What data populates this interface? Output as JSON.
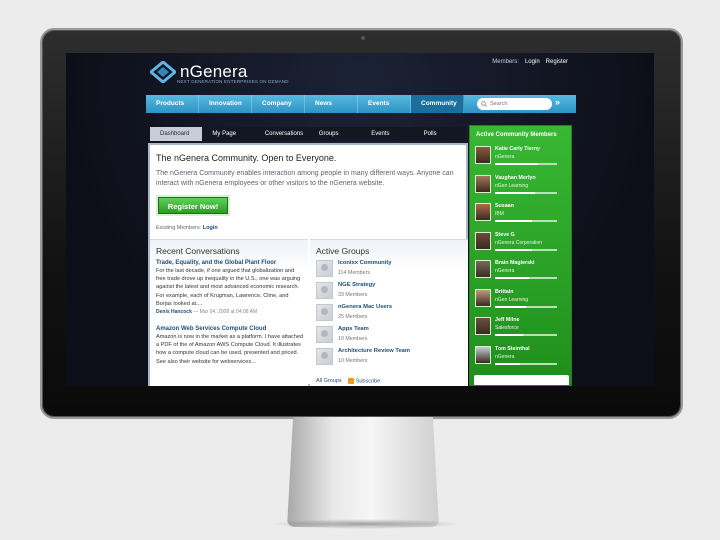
{
  "site": {
    "name": "nGenera",
    "tagline": "NEXT GENERATION ENTERPRISES ON DEMAND"
  },
  "toplinks": {
    "members_label": "Members:",
    "login": "Login",
    "register": "Register"
  },
  "mainnav": {
    "items": [
      "Products",
      "Innovation",
      "Company",
      "News",
      "Events",
      "Community"
    ],
    "active": "Community",
    "search_placeholder": "Search",
    "search_go": "»"
  },
  "subnav": {
    "tabs": [
      "Dashboard",
      "My Page",
      "Conversations",
      "Groups",
      "Events",
      "Polls"
    ],
    "active": "Dashboard"
  },
  "hero": {
    "title": "The nGenera Community. Open to Everyone.",
    "text": "The nGenera Community enables interaction among people in many different ways. Anyone can interact with nGenera employees or other visitors to the nGenera website.",
    "register_button": "Register Now!",
    "existing_label": "Existing Members:",
    "existing_login": "Login"
  },
  "recent_conversations": {
    "title": "Recent Conversations",
    "items": [
      {
        "title": "Trade, Equality, and the Global Plant Floor",
        "body": "For the last decade, if one argued that globalization and free trade drove up inequality in the U.S., one was arguing against the latest and most advanced economic research. For example, each of Krugman, Lawrence, Cline, and Borjas looked at....",
        "author": "Denis Hancock",
        "date": "— Mar 04, 2008 at 04:08 AM"
      },
      {
        "title": "Amazon Web Services Compute Cloud",
        "body": "Amazon is now in the market as a platform. I have attached a PDF of the of Amazon AWS Compute Cloud. It illustrates how a compute cloud can be used, presented and priced. See also their website for webservices...",
        "author": "",
        "date": ""
      }
    ]
  },
  "active_groups": {
    "title": "Active Groups",
    "items": [
      {
        "name": "Iconixx Community",
        "members": "114 Members"
      },
      {
        "name": "NGE Strategy",
        "members": "33 Members"
      },
      {
        "name": "nGenera Mac Users",
        "members": "25 Members"
      },
      {
        "name": "Apps Team",
        "members": "10 Members"
      },
      {
        "name": "Architecture Review Team",
        "members": "10 Members"
      }
    ],
    "all_groups": "All Groups",
    "subscribe": "Subscribe"
  },
  "active_members": {
    "title": "Active Community Members",
    "items": [
      {
        "name": "Katie Carly Tierny",
        "org": "nGenera",
        "activity": 0.7,
        "color": "#8a5a3c"
      },
      {
        "name": "Vaughan Merlyn",
        "org": "nGen Learning",
        "activity": 0.65,
        "color": "#a07a5a"
      },
      {
        "name": "Susaan",
        "org": "IBM",
        "activity": 0.6,
        "color": "#b06a4a"
      },
      {
        "name": "Steve G",
        "org": "nGenera Corporation",
        "activity": 0.6,
        "color": "#6a4a3a"
      },
      {
        "name": "Brain Magierski",
        "org": "nGenera",
        "activity": 0.55,
        "color": "#7a6a5a"
      },
      {
        "name": "Brittain",
        "org": "nGen Learning",
        "activity": 0.5,
        "color": "#c09a7a"
      },
      {
        "name": "Jeff Milne",
        "org": "Salesforce",
        "activity": 0.45,
        "color": "#6a5040"
      },
      {
        "name": "Tom Steinthal",
        "org": "nGenera",
        "activity": 0.4,
        "color": "#c8ccd0"
      }
    ]
  }
}
